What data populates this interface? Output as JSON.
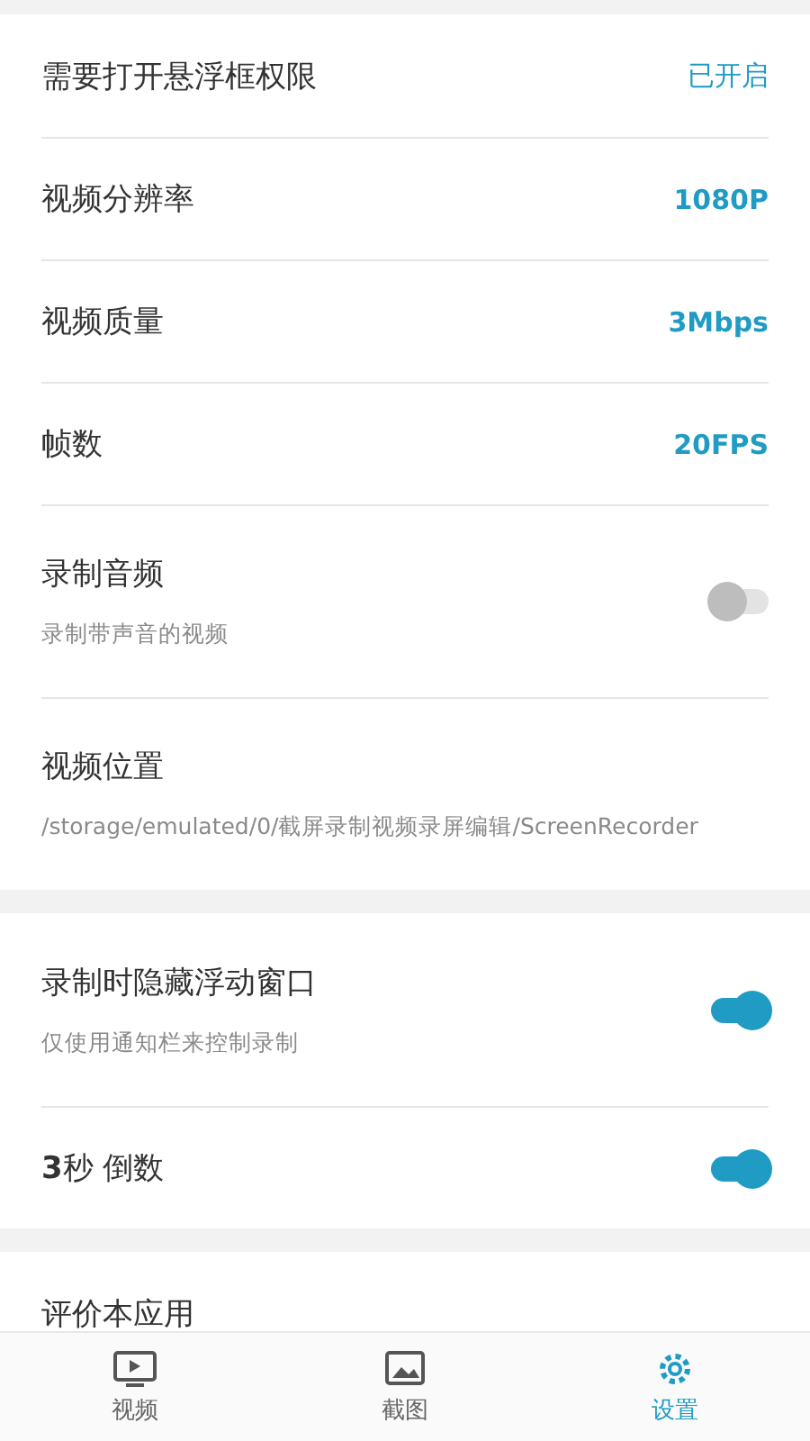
{
  "sections": [
    {
      "rows": [
        {
          "kind": "value",
          "title": "需要打开悬浮框权限",
          "value": "已开启",
          "bold": false
        },
        {
          "kind": "value",
          "title": "视频分辨率",
          "value": "1080P",
          "bold": true
        },
        {
          "kind": "value",
          "title": "视频质量",
          "value": "3Mbps",
          "bold": true
        },
        {
          "kind": "value",
          "title": "帧数",
          "value": "20FPS",
          "bold": true
        },
        {
          "kind": "switch",
          "title": "录制音频",
          "subtitle": "录制带声音的视频",
          "on": false
        },
        {
          "kind": "text",
          "title": "视频位置",
          "subtitle": "/storage/emulated/0/截屏录制视频录屏编辑/ScreenRecorder"
        }
      ]
    },
    {
      "rows": [
        {
          "kind": "switch",
          "title": "录制时隐藏浮动窗口",
          "subtitle": "仅使用通知栏来控制录制",
          "on": true
        },
        {
          "kind": "switch",
          "title": "**3**秒 倒数",
          "on": true
        }
      ]
    },
    {
      "rows": [
        {
          "kind": "text",
          "title": "评价本应用"
        }
      ]
    }
  ],
  "nav": [
    {
      "label": "视频",
      "kind": "tv",
      "selected": false
    },
    {
      "label": "截图",
      "kind": "image",
      "selected": false
    },
    {
      "label": "设置",
      "kind": "gear",
      "selected": true
    }
  ]
}
